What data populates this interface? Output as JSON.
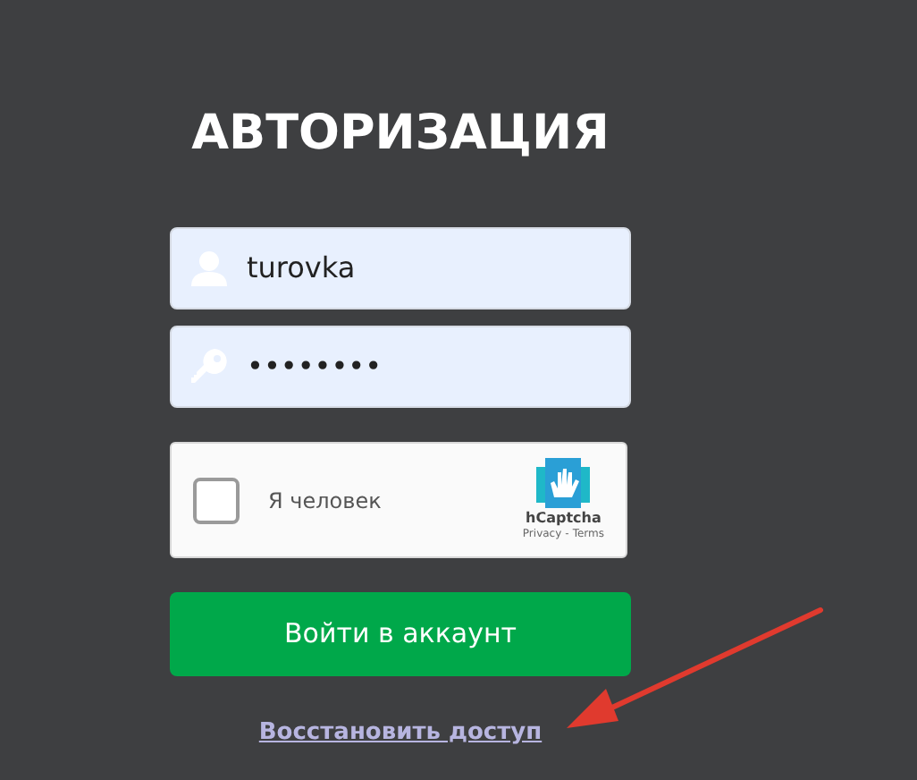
{
  "title": "АВТОРИЗАЦИЯ",
  "fields": [
    {
      "kind": "user",
      "value": "turovka"
    },
    {
      "kind": "password",
      "value": "••••••••"
    }
  ],
  "captcha": {
    "label": "Я человек",
    "checked": false,
    "brand": "hCaptcha",
    "privacy": "Privacy",
    "separator": "-",
    "terms": "Terms"
  },
  "login_button": "Войти в аккаунт",
  "recover_link": "Восстановить доступ"
}
